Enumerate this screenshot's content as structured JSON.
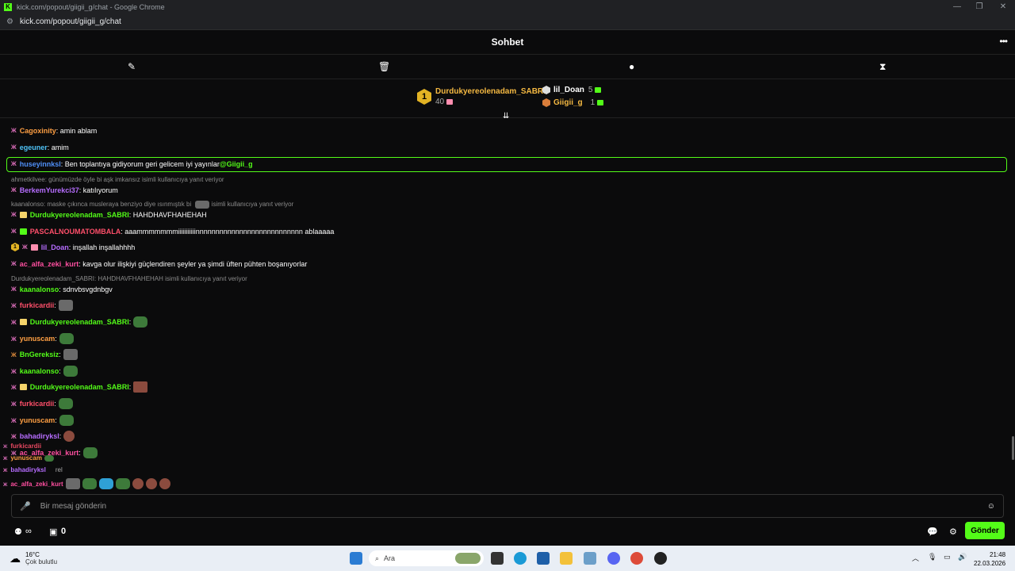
{
  "browser": {
    "window_title": "kick.com/popout/giigii_g/chat - Google Chrome",
    "favicon": "K",
    "url": "kick.com/popout/giigii_g/chat",
    "minimize": "—",
    "restore": "❐",
    "close": "✕"
  },
  "header": {
    "title": "Sohbet",
    "menu": "•••"
  },
  "tools": {
    "pin": "✎",
    "trash": "🗑",
    "chat": "●",
    "timer": "⧗"
  },
  "leaderboard": {
    "first": {
      "rank": "1",
      "name": "Durdukyereolenadam_SABRI",
      "count": "40"
    },
    "second": {
      "name": "lil_Doan",
      "count": "5"
    },
    "third": {
      "name": "Giigii_g",
      "count": "1"
    }
  },
  "scroll_icon": "⇊",
  "messages": [
    {
      "user": "Cagoxinity",
      "color": "#ff9f43",
      "text": ": amin ablam"
    },
    {
      "user": "egeuner",
      "color": "#4fc3f7",
      "text": ": amim"
    },
    {
      "user": "huseyinnksl",
      "color": "#4f8ff7",
      "text": ": Ben toplantıya gidiyorum geri gelicem iyi yayınlar ",
      "mention": "@Giigii_g"
    },
    {
      "reply": "ahmetkilvee: günümüzde öyle bi aşk imkansız isimli kullanıcıya yanıt veriyor"
    },
    {
      "user": "BerkemYurekci37",
      "color": "#b66dff",
      "text": ": katılıyorum"
    },
    {
      "reply": "kaanalonso: maske çıkınca musleraya benziyo diye ısınmıştık bi",
      "reply_tail": "isimli kullanıcıya yanıt veriyor"
    },
    {
      "user": "Durdukyereolenadam_SABRI",
      "color": "#53fc18",
      "text": ": HAHDHAVFHAHEHAH"
    },
    {
      "user": "PASCALNOUMATOMBALA",
      "color": "#ff4f6a",
      "text": ": aaammmmmmmiiiiiiiiiiinnnnnnnnnnnnnnnnnnnnnnnnnnn ablaaaaa"
    },
    {
      "user": "lil_Doan",
      "color": "#b66dff",
      "text": ": inşallah inşallahhhh"
    },
    {
      "user": "ac_alfa_zeki_kurt",
      "color": "#ff4fa0",
      "text": ": kavga olur ilişkiyi güçlendiren şeyler ya şimdi üften pühten boşanıyorlar"
    },
    {
      "reply": "Durdukyereolenadam_SABRI: HAHDHAVFHAHEHAH isimli kullanıcıya yanıt veriyor"
    },
    {
      "user": "kaanalonso",
      "color": "#53fc18",
      "text": ": sdnvbsvgdnbgv"
    },
    {
      "user": "furkicardii",
      "color": "#ff4f6a",
      "text": ":"
    },
    {
      "user": "Durdukyereolenadam_SABRI",
      "color": "#53fc18",
      "text": ":"
    },
    {
      "user": "yunuscam",
      "color": "#ff9f43",
      "text": ":"
    },
    {
      "user": "BnGereksiz",
      "color": "#53fc18",
      "text": ":"
    },
    {
      "user": "kaanalonso",
      "color": "#53fc18",
      "text": ":"
    },
    {
      "user": "Durdukyereolenadam_SABRI",
      "color": "#53fc18",
      "text": ":"
    },
    {
      "user": "furkicardii",
      "color": "#ff4f6a",
      "text": ":"
    },
    {
      "user": "yunuscam",
      "color": "#ff9f43",
      "text": ":"
    },
    {
      "user": "bahadiryksl",
      "color": "#b66dff",
      "text": ":"
    },
    {
      "user": "ac_alfa_zeki_kurt",
      "color": "#ff4fa0",
      "text": ":"
    }
  ],
  "overlay": {
    "u1": "furkicardii",
    "u2": "yunuscam",
    "u3": "bahadiryksl",
    "u4": "ac_alfa_zeki_kurt",
    "tail": "rel"
  },
  "input": {
    "placeholder": "Bir mesaj gönderin",
    "mic": "🎤",
    "emoji": "☺"
  },
  "bottom": {
    "points": "0",
    "send": "Gönder",
    "chat_icon": "💬",
    "settings_icon": "⚙",
    "infinite": "∞"
  },
  "taskbar": {
    "temp": "16°C",
    "weather": "Çok bulutlu",
    "search": "Ara",
    "time": "21:48",
    "date": "22.03.2026"
  },
  "colors": {
    "accent": "#53fc18",
    "gold": "#e2b324"
  }
}
